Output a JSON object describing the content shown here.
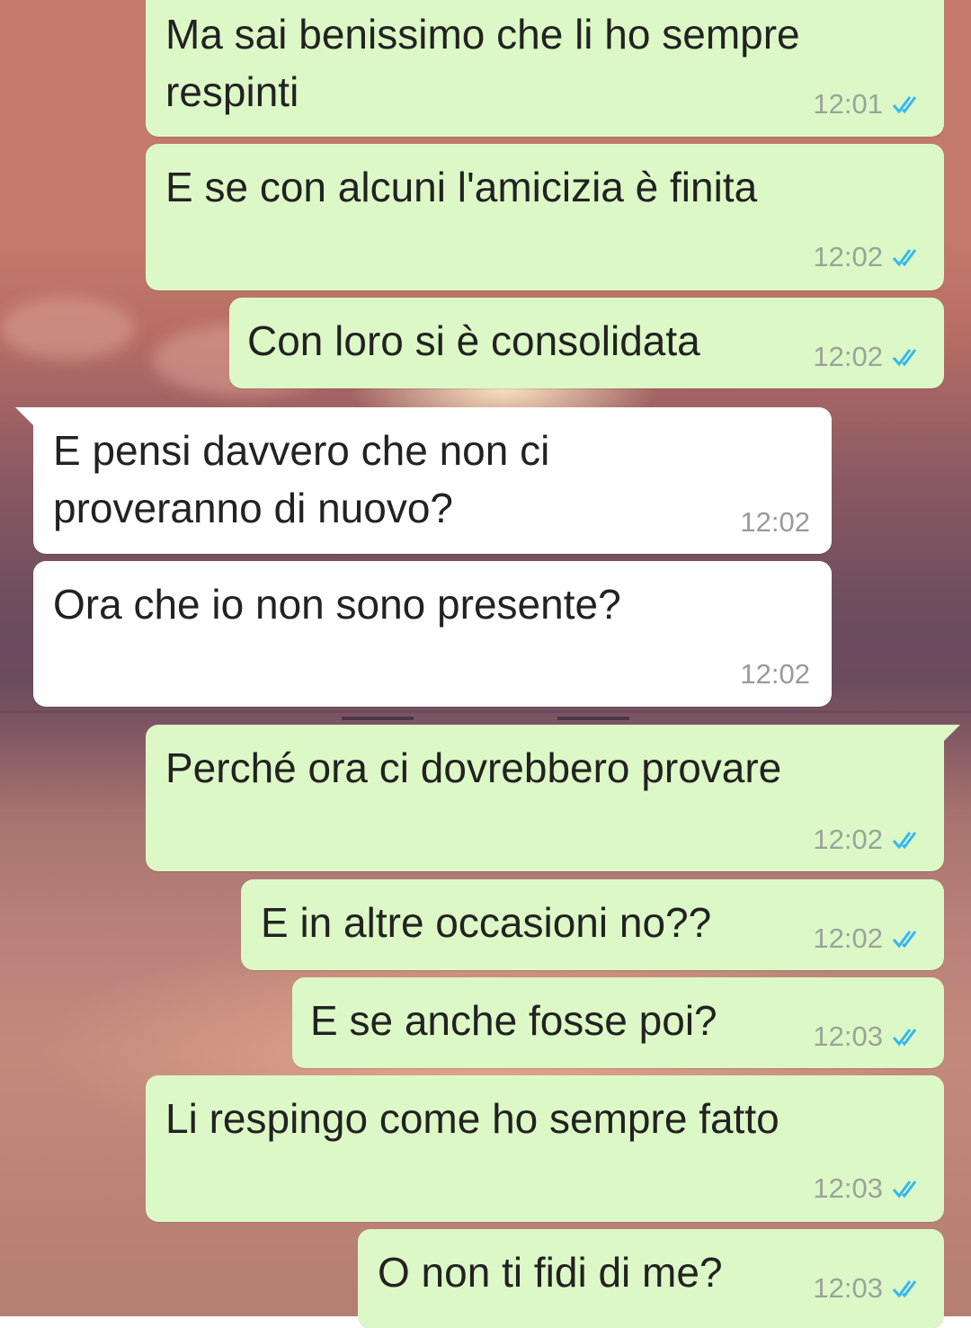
{
  "colors": {
    "outgoing_bubble": "#dcf8c6",
    "incoming_bubble": "#ffffff",
    "read_ticks": "#34b7f1"
  },
  "messages": [
    {
      "direction": "out",
      "lines": [
        "Ma sai benissimo che li ho sempre",
        "respinti"
      ],
      "time": "12:01",
      "status": "read"
    },
    {
      "direction": "out",
      "lines": [
        "E se con alcuni l'amicizia è finita"
      ],
      "time": "12:02",
      "status": "read"
    },
    {
      "direction": "out",
      "lines": [
        "Con loro si è consolidata"
      ],
      "time": "12:02",
      "status": "read"
    },
    {
      "direction": "in",
      "lines": [
        "E pensi davvero che non ci",
        "proveranno di nuovo?"
      ],
      "time": "12:02"
    },
    {
      "direction": "in",
      "lines": [
        "Ora che io non sono presente?"
      ],
      "time": "12:02"
    },
    {
      "direction": "out",
      "lines": [
        "Perché ora ci dovrebbero provare"
      ],
      "time": "12:02",
      "status": "read"
    },
    {
      "direction": "out",
      "lines": [
        "E in altre occasioni no??"
      ],
      "time": "12:02",
      "status": "read"
    },
    {
      "direction": "out",
      "lines": [
        "E se anche fosse poi?"
      ],
      "time": "12:03",
      "status": "read"
    },
    {
      "direction": "out",
      "lines": [
        "Li respingo come ho sempre fatto"
      ],
      "time": "12:03",
      "status": "read"
    },
    {
      "direction": "out",
      "lines": [
        "O non ti fidi di me?"
      ],
      "time": "12:03",
      "status": "read"
    }
  ]
}
